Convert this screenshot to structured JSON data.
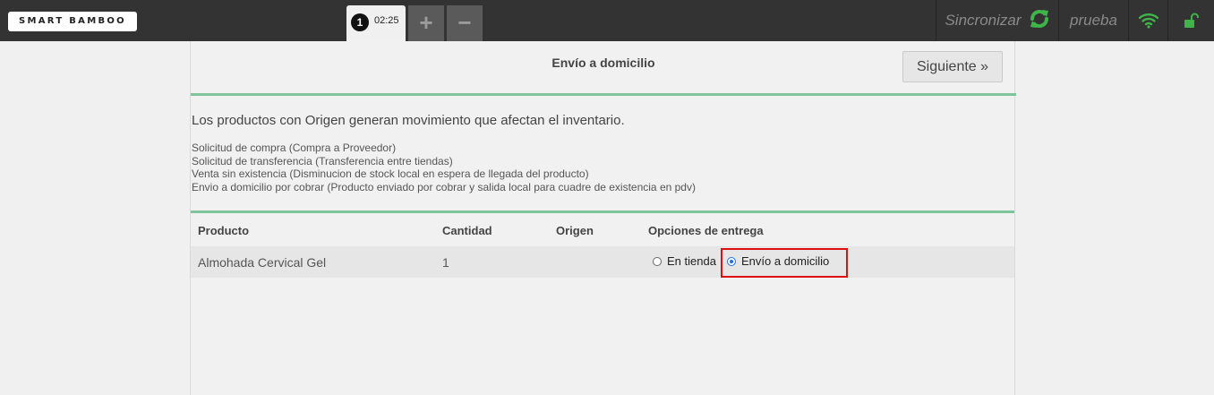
{
  "header": {
    "logo_text": "SMART BAMBOO",
    "tab": {
      "number": "1",
      "time": "02:25"
    },
    "add_tab_label": "+",
    "remove_tab_label": "−",
    "sync_label": "Sincronizar",
    "user_label": "prueba",
    "icons": {
      "sync": "refresh-icon",
      "wifi": "wifi-icon",
      "lock": "unlock-icon"
    },
    "colors": {
      "accent_green": "#3fb549"
    }
  },
  "page": {
    "title": "Envío a domicilio",
    "next_label": "Siguiente »",
    "intro": "Los productos con Origen generan movimiento que afectan el inventario.",
    "notes": [
      "Solicitud de compra (Compra a Proveedor)",
      "Solicitud de transferencia (Transferencia entre tiendas)",
      "Venta sin existencia (Disminucion de stock local en espera de llegada del producto)",
      "Envio a domicilio por cobrar (Producto enviado por cobrar y salida local para cuadre de existencia en pdv)"
    ]
  },
  "table": {
    "columns": [
      "Producto",
      "Cantidad",
      "Origen",
      "Opciones de entrega"
    ],
    "rows": [
      {
        "producto": "Almohada Cervical Gel",
        "cantidad": "1",
        "origen": "",
        "opciones": [
          {
            "label": "En tienda",
            "selected": false
          },
          {
            "label": "Envío a domicilio",
            "selected": true
          }
        ]
      }
    ]
  }
}
